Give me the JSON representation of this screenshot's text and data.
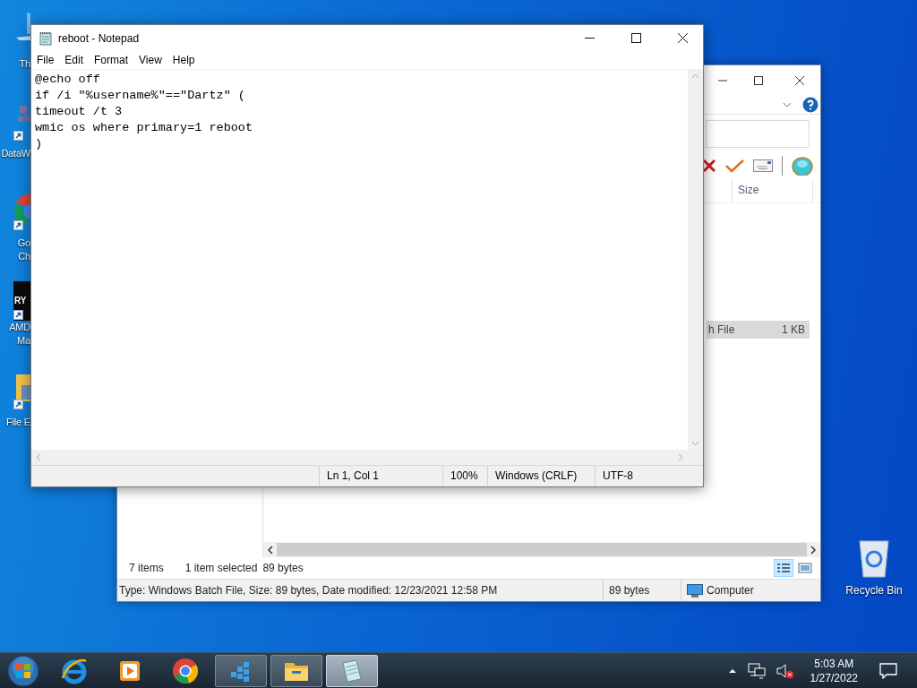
{
  "desktop_icons": [
    {
      "kind": "computer",
      "label_lines": [
        "Th"
      ],
      "shortcut": false
    },
    {
      "kind": "cubes",
      "label_lines": [
        "DataW"
      ],
      "shortcut": true
    },
    {
      "kind": "chrome",
      "label_lines": [
        "Go",
        "Ch"
      ],
      "shortcut": true
    },
    {
      "kind": "ryzen",
      "label_lines": [
        "AMD",
        "Ma"
      ],
      "shortcut": true,
      "badge_text": "RY"
    },
    {
      "kind": "folder",
      "label_lines": [
        "File E"
      ],
      "shortcut": true
    }
  ],
  "recycle_bin": {
    "label": "Recycle Bin"
  },
  "explorer": {
    "column_header": "Size",
    "row": {
      "type": "h File",
      "size": "1 KB",
      "selected": true
    },
    "status": {
      "count": "7 items",
      "selection": "1 item selected",
      "selection_size": "89 bytes"
    },
    "view_buttons": [
      {
        "kind": "details",
        "selected": true
      },
      {
        "kind": "preview",
        "selected": false
      }
    ],
    "details_bar": {
      "description": "Type: Windows Batch File, Size: 89 bytes, Date modified: 12/23/2021 12:58 PM",
      "size": "89 bytes",
      "zone": "Computer"
    }
  },
  "notepad": {
    "title": "reboot - Notepad",
    "menu": [
      "File",
      "Edit",
      "Format",
      "View",
      "Help"
    ],
    "lines": [
      "@echo off",
      "if /i \"%username%\"==\"Dartz\" (",
      "timeout /t 3",
      "wmic os where primary=1 reboot",
      ")"
    ],
    "status_bar": {
      "position": "Ln 1, Col 1",
      "zoom": "100%",
      "line_ending": "Windows (CRLF)",
      "encoding": "UTF-8"
    }
  },
  "taskbar": {
    "items": [
      {
        "kind": "ie",
        "open": false,
        "selected": false
      },
      {
        "kind": "media",
        "open": false,
        "selected": false
      },
      {
        "kind": "chrome",
        "open": false,
        "selected": false
      },
      {
        "kind": "cubes",
        "open": true,
        "selected": false
      },
      {
        "kind": "folder",
        "open": true,
        "selected": false
      },
      {
        "kind": "notepad",
        "open": true,
        "selected": true
      }
    ],
    "time": "5:03 AM",
    "date": "1/27/2022"
  }
}
